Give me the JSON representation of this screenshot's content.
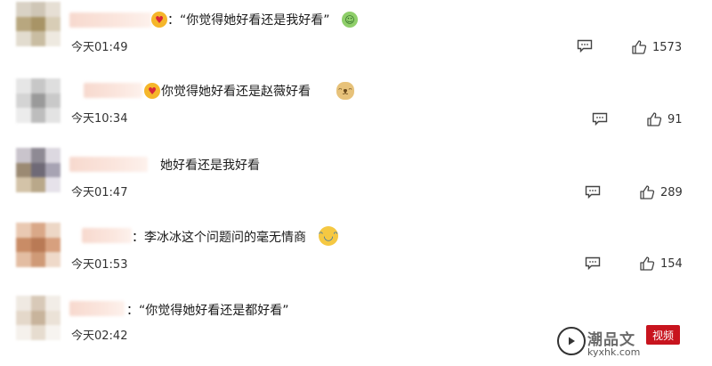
{
  "comments": [
    {
      "text": "：“你觉得她好看还是我好看”",
      "time": "今天01:49",
      "likes": "1573",
      "emoji": "love",
      "tail_emoji": "melon"
    },
    {
      "text": "你觉得她好看还是赵薇好看",
      "time": "今天10:34",
      "likes": "91",
      "emoji": "love",
      "tail_emoji": "doge"
    },
    {
      "text": "她好看还是我好看",
      "time": "今天01:47",
      "likes": "289"
    },
    {
      "text": "：李冰冰这个问题问的毫无情商",
      "time": "今天01:53",
      "likes": "154",
      "tail_emoji": "laugh"
    },
    {
      "text": "：“你觉得她好看还是都好看”",
      "time": "今天02:42"
    }
  ],
  "watermark": {
    "title": "潮品文",
    "seal": "视频",
    "url": "kyxhk.com"
  },
  "colors": {
    "text": "#1a1a1a",
    "meta": "#333333",
    "seal": "#c8141e",
    "name_blur": "#f7d9ce"
  }
}
